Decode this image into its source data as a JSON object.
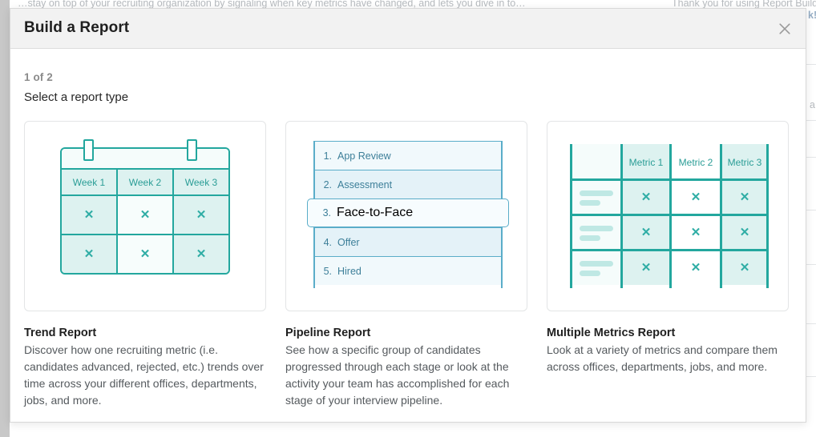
{
  "backdrop": {
    "text_left": "…stay on top of your recruiting organization by signaling when key metrics have changed, and lets you dive in to…",
    "text_right": "Thank you for using Report Builder",
    "text_far_right": "k!",
    "text_a": "a"
  },
  "modal": {
    "title": "Build a Report",
    "close_icon": "close-icon",
    "step_counter": "1 of 2",
    "step_heading": "Select a report type"
  },
  "cards": [
    {
      "id": "trend-report",
      "title": "Trend Report",
      "description": "Discover how one recruiting metric (i.e. candidates advanced, rejected, etc.) trends over time across your different offices, departments, jobs, and more.",
      "visual": {
        "type": "calendar-grid",
        "column_headers": [
          "Week 1",
          "Week 2",
          "Week 3"
        ],
        "cell_mark": "✕",
        "rows": 2
      }
    },
    {
      "id": "pipeline-report",
      "title": "Pipeline Report",
      "description": "See how a specific group of candidates progressed through each stage or look at the activity your team has accomplished for each stage of your interview pipeline.",
      "visual": {
        "type": "pipeline-stages",
        "highlighted_index": 2,
        "stages": [
          {
            "number": "1.",
            "label": "App Review"
          },
          {
            "number": "2.",
            "label": "Assessment"
          },
          {
            "number": "3.",
            "label": "Face-to-Face"
          },
          {
            "number": "4.",
            "label": "Offer"
          },
          {
            "number": "5.",
            "label": "Hired"
          }
        ]
      }
    },
    {
      "id": "multiple-metrics-report",
      "title": "Multiple Metrics Report",
      "description": "Look at a variety of metrics and compare them across offices, departments, jobs, and more.",
      "visual": {
        "type": "metrics-table",
        "column_headers": [
          "Metric 1",
          "Metric 2",
          "Metric 3"
        ],
        "cell_mark": "✕",
        "rows": 3
      }
    }
  ],
  "colors": {
    "teal": "#23a79e",
    "teal_light_fill": "#ddf2f0",
    "teal_text": "#2a9d96",
    "blue": "#5aadc9",
    "blue_light_fill": "#e4f2f8",
    "blue_text": "#3d7f99",
    "header_bg": "#f2f2f2",
    "body_text": "#555a5e",
    "title_text": "#1f1f1f"
  }
}
